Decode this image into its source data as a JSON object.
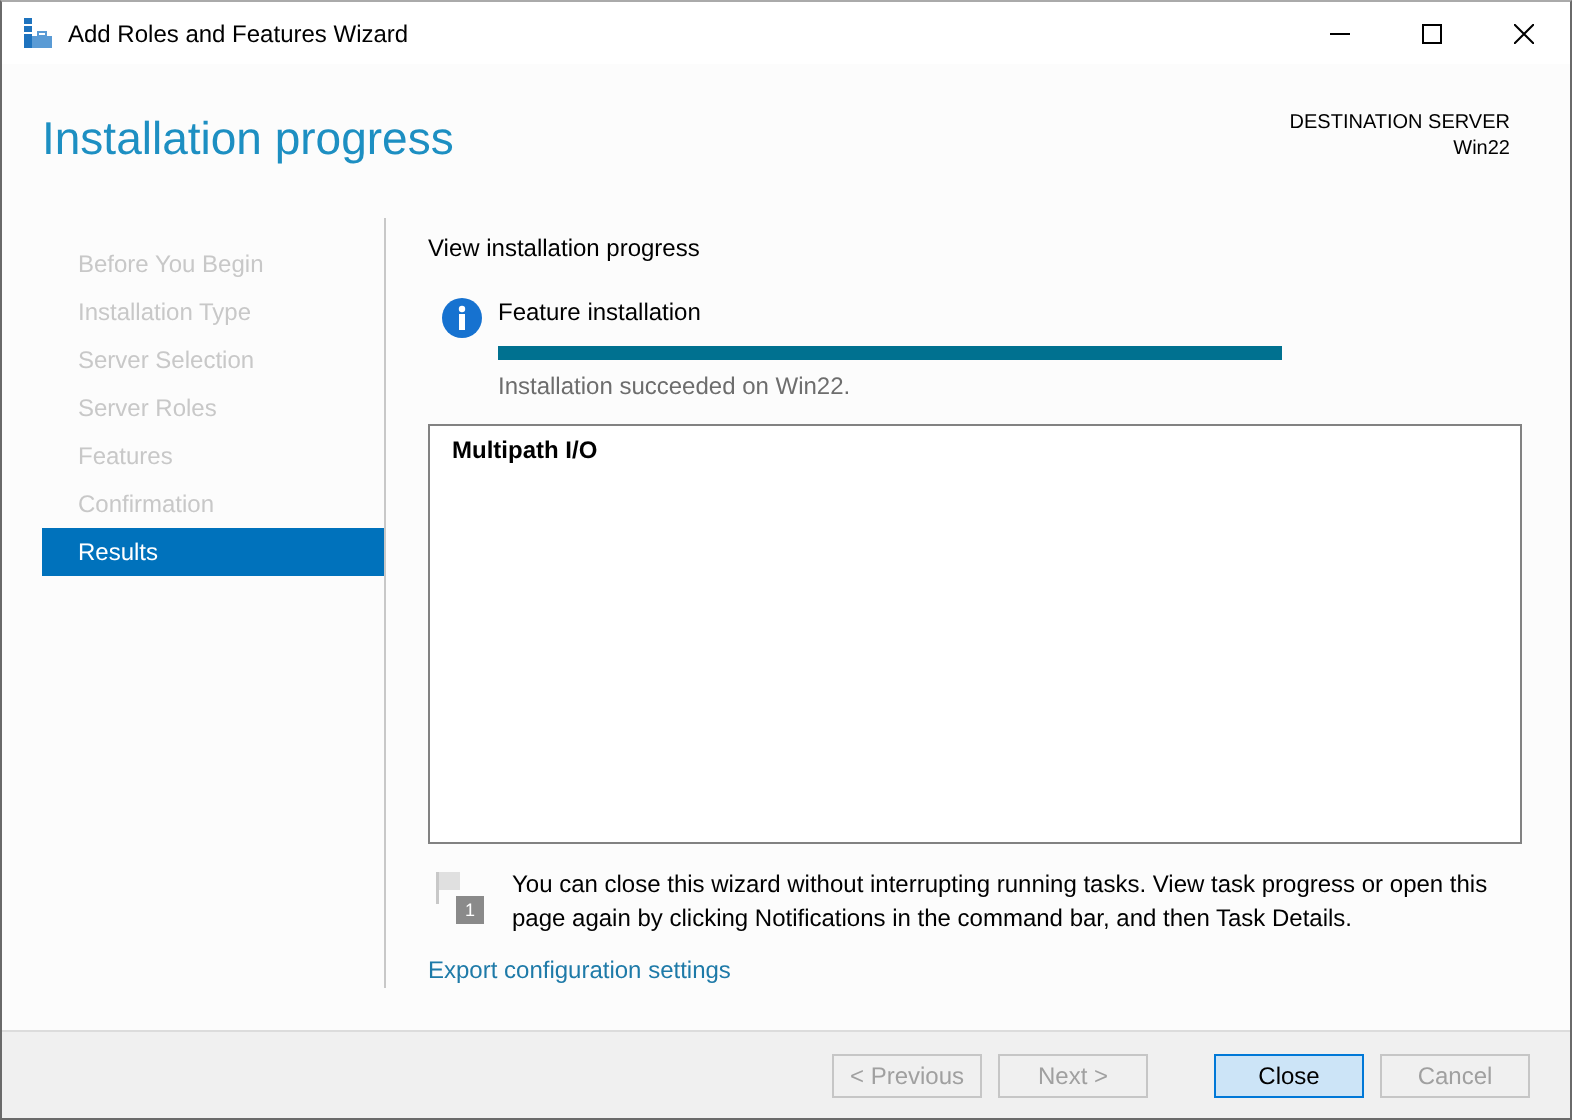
{
  "window": {
    "title": "Add Roles and Features Wizard"
  },
  "header": {
    "title": "Installation progress",
    "destination_label": "DESTINATION SERVER",
    "destination_server": "Win22"
  },
  "steps": [
    {
      "label": "Before You Begin",
      "selected": false
    },
    {
      "label": "Installation Type",
      "selected": false
    },
    {
      "label": "Server Selection",
      "selected": false
    },
    {
      "label": "Server Roles",
      "selected": false
    },
    {
      "label": "Features",
      "selected": false
    },
    {
      "label": "Confirmation",
      "selected": false
    },
    {
      "label": "Results",
      "selected": true
    }
  ],
  "main": {
    "heading": "View installation progress",
    "task": {
      "title": "Feature installation",
      "level": 1,
      "status": "Installation succeeded on Win22."
    },
    "results": [
      "Multipath I/O"
    ],
    "note": {
      "badge": "1",
      "text": "You can close this wizard without interrupting running tasks. View task progress or open this page again by clicking Notifications in the command bar, and then Task Details."
    },
    "link": "Export configuration settings"
  },
  "buttons": [
    {
      "label": "< Previous",
      "disabled": true,
      "default": false
    },
    {
      "label": "Next >",
      "disabled": true,
      "default": false
    },
    {
      "label": "Close",
      "disabled": false,
      "default": true
    },
    {
      "label": "Cancel",
      "disabled": true,
      "default": false
    }
  ]
}
